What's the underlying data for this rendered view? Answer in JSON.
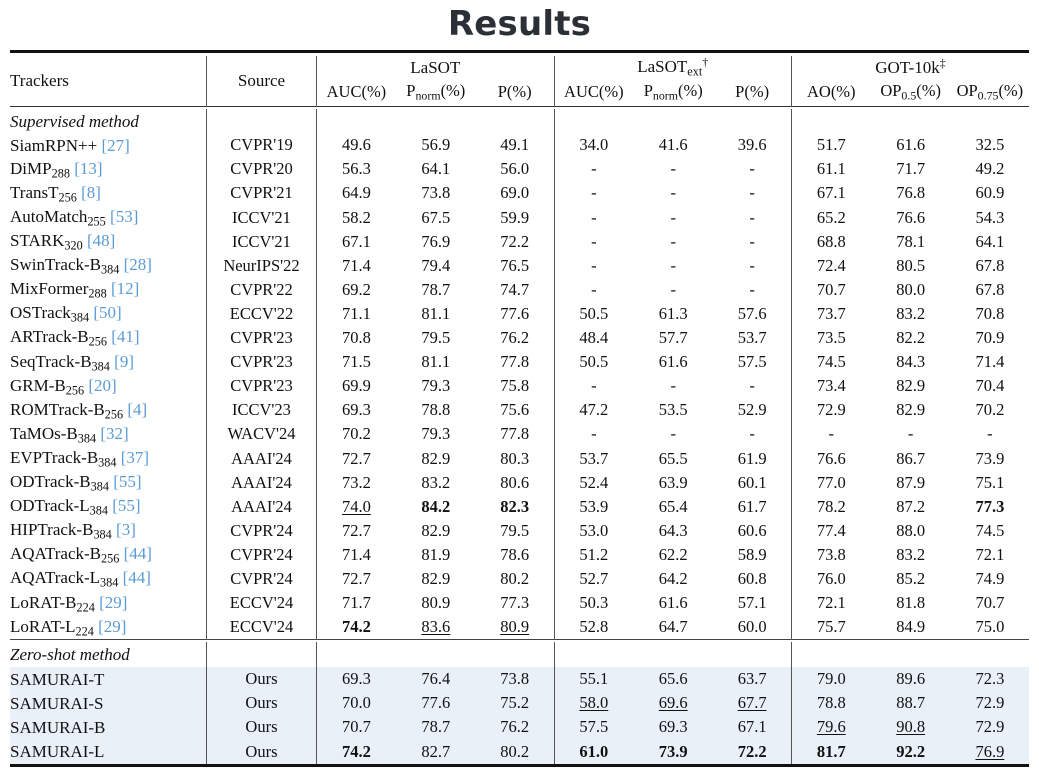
{
  "page": {
    "title": "Results"
  },
  "table": {
    "header": {
      "trackers": "Trackers",
      "source": "Source",
      "groups": [
        {
          "name": "LaSOT",
          "marker": ""
        },
        {
          "name": "LaSOText",
          "marker": "†"
        },
        {
          "name": "GOT-10k",
          "marker": "‡"
        }
      ],
      "subcols": [
        "AUC(%)",
        "Pnorm(%)",
        "P(%)",
        "AUC(%)",
        "Pnorm(%)",
        "P(%)",
        "AO(%)",
        "OP0.5(%)",
        "OP0.75(%)"
      ]
    },
    "sections": [
      {
        "label": "Supervised method",
        "highlight": false
      },
      {
        "label": "Zero-shot method",
        "highlight": true
      }
    ],
    "rows_supervised": [
      {
        "name": "SiamRPN++",
        "sub": "",
        "ref": "[27]",
        "source": "CVPR'19",
        "values": [
          "49.6",
          "56.9",
          "49.1",
          "34.0",
          "41.6",
          "39.6",
          "51.7",
          "61.6",
          "32.5"
        ],
        "styles": [
          "",
          "",
          "",
          "",
          "",
          "",
          "",
          "",
          ""
        ]
      },
      {
        "name": "DiMP",
        "sub": "288",
        "ref": "[13]",
        "source": "CVPR'20",
        "values": [
          "56.3",
          "64.1",
          "56.0",
          "-",
          "-",
          "-",
          "61.1",
          "71.7",
          "49.2"
        ],
        "styles": [
          "",
          "",
          "",
          "",
          "",
          "",
          "",
          "",
          ""
        ]
      },
      {
        "name": "TransT",
        "sub": "256",
        "ref": "[8]",
        "source": "CVPR'21",
        "values": [
          "64.9",
          "73.8",
          "69.0",
          "-",
          "-",
          "-",
          "67.1",
          "76.8",
          "60.9"
        ],
        "styles": [
          "",
          "",
          "",
          "",
          "",
          "",
          "",
          "",
          ""
        ]
      },
      {
        "name": "AutoMatch",
        "sub": "255",
        "ref": "[53]",
        "source": "ICCV'21",
        "values": [
          "58.2",
          "67.5",
          "59.9",
          "-",
          "-",
          "-",
          "65.2",
          "76.6",
          "54.3"
        ],
        "styles": [
          "",
          "",
          "",
          "",
          "",
          "",
          "",
          "",
          ""
        ]
      },
      {
        "name": "STARK",
        "sub": "320",
        "ref": "[48]",
        "source": "ICCV'21",
        "values": [
          "67.1",
          "76.9",
          "72.2",
          "-",
          "-",
          "-",
          "68.8",
          "78.1",
          "64.1"
        ],
        "styles": [
          "",
          "",
          "",
          "",
          "",
          "",
          "",
          "",
          ""
        ]
      },
      {
        "name": "SwinTrack-B",
        "sub": "384",
        "ref": "[28]",
        "source": "NeurIPS'22",
        "values": [
          "71.4",
          "79.4",
          "76.5",
          "-",
          "-",
          "-",
          "72.4",
          "80.5",
          "67.8"
        ],
        "styles": [
          "",
          "",
          "",
          "",
          "",
          "",
          "",
          "",
          ""
        ]
      },
      {
        "name": "MixFormer",
        "sub": "288",
        "ref": "[12]",
        "source": "CVPR'22",
        "values": [
          "69.2",
          "78.7",
          "74.7",
          "-",
          "-",
          "-",
          "70.7",
          "80.0",
          "67.8"
        ],
        "styles": [
          "",
          "",
          "",
          "",
          "",
          "",
          "",
          "",
          ""
        ]
      },
      {
        "name": "OSTrack",
        "sub": "384",
        "ref": "[50]",
        "source": "ECCV'22",
        "values": [
          "71.1",
          "81.1",
          "77.6",
          "50.5",
          "61.3",
          "57.6",
          "73.7",
          "83.2",
          "70.8"
        ],
        "styles": [
          "",
          "",
          "",
          "",
          "",
          "",
          "",
          "",
          ""
        ]
      },
      {
        "name": "ARTrack-B",
        "sub": "256",
        "ref": "[41]",
        "source": "CVPR'23",
        "values": [
          "70.8",
          "79.5",
          "76.2",
          "48.4",
          "57.7",
          "53.7",
          "73.5",
          "82.2",
          "70.9"
        ],
        "styles": [
          "",
          "",
          "",
          "",
          "",
          "",
          "",
          "",
          ""
        ]
      },
      {
        "name": "SeqTrack-B",
        "sub": "384",
        "ref": "[9]",
        "source": "CVPR'23",
        "values": [
          "71.5",
          "81.1",
          "77.8",
          "50.5",
          "61.6",
          "57.5",
          "74.5",
          "84.3",
          "71.4"
        ],
        "styles": [
          "",
          "",
          "",
          "",
          "",
          "",
          "",
          "",
          ""
        ]
      },
      {
        "name": "GRM-B",
        "sub": "256",
        "ref": "[20]",
        "source": "CVPR'23",
        "values": [
          "69.9",
          "79.3",
          "75.8",
          "-",
          "-",
          "-",
          "73.4",
          "82.9",
          "70.4"
        ],
        "styles": [
          "",
          "",
          "",
          "",
          "",
          "",
          "",
          "",
          ""
        ]
      },
      {
        "name": "ROMTrack-B",
        "sub": "256",
        "ref": "[4]",
        "source": "ICCV'23",
        "values": [
          "69.3",
          "78.8",
          "75.6",
          "47.2",
          "53.5",
          "52.9",
          "72.9",
          "82.9",
          "70.2"
        ],
        "styles": [
          "",
          "",
          "",
          "",
          "",
          "",
          "",
          "",
          ""
        ]
      },
      {
        "name": "TaMOs-B",
        "sub": "384",
        "ref": "[32]",
        "source": "WACV'24",
        "values": [
          "70.2",
          "79.3",
          "77.8",
          "-",
          "-",
          "-",
          "-",
          "-",
          "-"
        ],
        "styles": [
          "",
          "",
          "",
          "",
          "",
          "",
          "",
          "",
          ""
        ]
      },
      {
        "name": "EVPTrack-B",
        "sub": "384",
        "ref": "[37]",
        "source": "AAAI'24",
        "values": [
          "72.7",
          "82.9",
          "80.3",
          "53.7",
          "65.5",
          "61.9",
          "76.6",
          "86.7",
          "73.9"
        ],
        "styles": [
          "",
          "",
          "",
          "",
          "",
          "",
          "",
          "",
          ""
        ]
      },
      {
        "name": "ODTrack-B",
        "sub": "384",
        "ref": "[55]",
        "source": "AAAI'24",
        "values": [
          "73.2",
          "83.2",
          "80.6",
          "52.4",
          "63.9",
          "60.1",
          "77.0",
          "87.9",
          "75.1"
        ],
        "styles": [
          "",
          "",
          "",
          "",
          "",
          "",
          "",
          "",
          ""
        ]
      },
      {
        "name": "ODTrack-L",
        "sub": "384",
        "ref": "[55]",
        "source": "AAAI'24",
        "values": [
          "74.0",
          "84.2",
          "82.3",
          "53.9",
          "65.4",
          "61.7",
          "78.2",
          "87.2",
          "77.3"
        ],
        "styles": [
          "u",
          "b",
          "b",
          "",
          "",
          "",
          "",
          "",
          "b"
        ]
      },
      {
        "name": "HIPTrack-B",
        "sub": "384",
        "ref": "[3]",
        "source": "CVPR'24",
        "values": [
          "72.7",
          "82.9",
          "79.5",
          "53.0",
          "64.3",
          "60.6",
          "77.4",
          "88.0",
          "74.5"
        ],
        "styles": [
          "",
          "",
          "",
          "",
          "",
          "",
          "",
          "",
          ""
        ]
      },
      {
        "name": "AQATrack-B",
        "sub": "256",
        "ref": "[44]",
        "source": "CVPR'24",
        "values": [
          "71.4",
          "81.9",
          "78.6",
          "51.2",
          "62.2",
          "58.9",
          "73.8",
          "83.2",
          "72.1"
        ],
        "styles": [
          "",
          "",
          "",
          "",
          "",
          "",
          "",
          "",
          ""
        ]
      },
      {
        "name": "AQATrack-L",
        "sub": "384",
        "ref": "[44]",
        "source": "CVPR'24",
        "values": [
          "72.7",
          "82.9",
          "80.2",
          "52.7",
          "64.2",
          "60.8",
          "76.0",
          "85.2",
          "74.9"
        ],
        "styles": [
          "",
          "",
          "",
          "",
          "",
          "",
          "",
          "",
          ""
        ]
      },
      {
        "name": "LoRAT-B",
        "sub": "224",
        "ref": "[29]",
        "source": "ECCV'24",
        "values": [
          "71.7",
          "80.9",
          "77.3",
          "50.3",
          "61.6",
          "57.1",
          "72.1",
          "81.8",
          "70.7"
        ],
        "styles": [
          "",
          "",
          "",
          "",
          "",
          "",
          "",
          "",
          ""
        ]
      },
      {
        "name": "LoRAT-L",
        "sub": "224",
        "ref": "[29]",
        "source": "ECCV'24",
        "values": [
          "74.2",
          "83.6",
          "80.9",
          "52.8",
          "64.7",
          "60.0",
          "75.7",
          "84.9",
          "75.0"
        ],
        "styles": [
          "b",
          "u",
          "u",
          "",
          "",
          "",
          "",
          "",
          ""
        ]
      }
    ],
    "rows_zeroshot": [
      {
        "name": "SAMURAI-T",
        "sub": "",
        "ref": "",
        "source": "Ours",
        "values": [
          "69.3",
          "76.4",
          "73.8",
          "55.1",
          "65.6",
          "63.7",
          "79.0",
          "89.6",
          "72.3"
        ],
        "styles": [
          "",
          "",
          "",
          "",
          "",
          "",
          "",
          "",
          ""
        ]
      },
      {
        "name": "SAMURAI-S",
        "sub": "",
        "ref": "",
        "source": "Ours",
        "values": [
          "70.0",
          "77.6",
          "75.2",
          "58.0",
          "69.6",
          "67.7",
          "78.8",
          "88.7",
          "72.9"
        ],
        "styles": [
          "",
          "",
          "",
          "u",
          "u",
          "u",
          "",
          "",
          ""
        ]
      },
      {
        "name": "SAMURAI-B",
        "sub": "",
        "ref": "",
        "source": "Ours",
        "values": [
          "70.7",
          "78.7",
          "76.2",
          "57.5",
          "69.3",
          "67.1",
          "79.6",
          "90.8",
          "72.9"
        ],
        "styles": [
          "",
          "",
          "",
          "",
          "",
          "",
          "u",
          "u",
          ""
        ]
      },
      {
        "name": "SAMURAI-L",
        "sub": "",
        "ref": "",
        "source": "Ours",
        "values": [
          "74.2",
          "82.7",
          "80.2",
          "61.0",
          "73.9",
          "72.2",
          "81.7",
          "92.2",
          "76.9"
        ],
        "styles": [
          "b",
          "",
          "",
          "b",
          "b",
          "b",
          "b",
          "b",
          "u"
        ]
      }
    ]
  },
  "colors": {
    "reference_link": "#5b9bd5",
    "highlight_row": "#e9f0f8",
    "title": "#2b2f36",
    "rule": "#111111"
  }
}
